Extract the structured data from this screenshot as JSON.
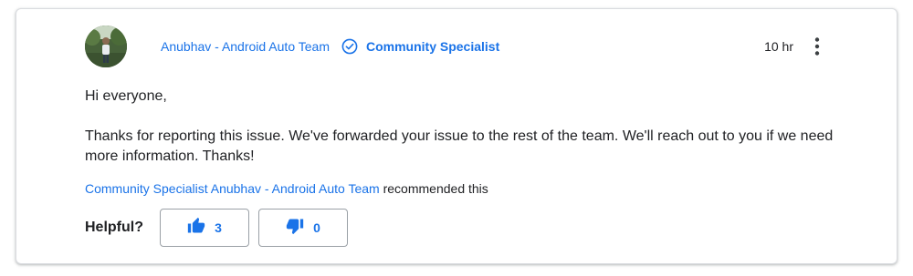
{
  "post": {
    "author": "Anubhav - Android Auto Team",
    "role": "Community Specialist",
    "timestamp": "10 hr",
    "greeting": "Hi everyone,",
    "message": "Thanks for reporting this issue. We've forwarded your issue to the rest of the team. We'll reach out to you if we need more information. Thanks!"
  },
  "recommendation": {
    "role": "Community Specialist",
    "name": "Anubhav - Android Auto Team",
    "suffix": "recommended this"
  },
  "helpful": {
    "label": "Helpful?",
    "upvotes": "3",
    "downvotes": "0"
  },
  "icons": {
    "verified": "verified-check-icon",
    "more": "more-vert-icon",
    "thumb_up": "thumb-up-icon",
    "thumb_down": "thumb-down-icon"
  },
  "colors": {
    "accent": "#1a73e8",
    "text": "#202124",
    "border": "#dadce0"
  }
}
